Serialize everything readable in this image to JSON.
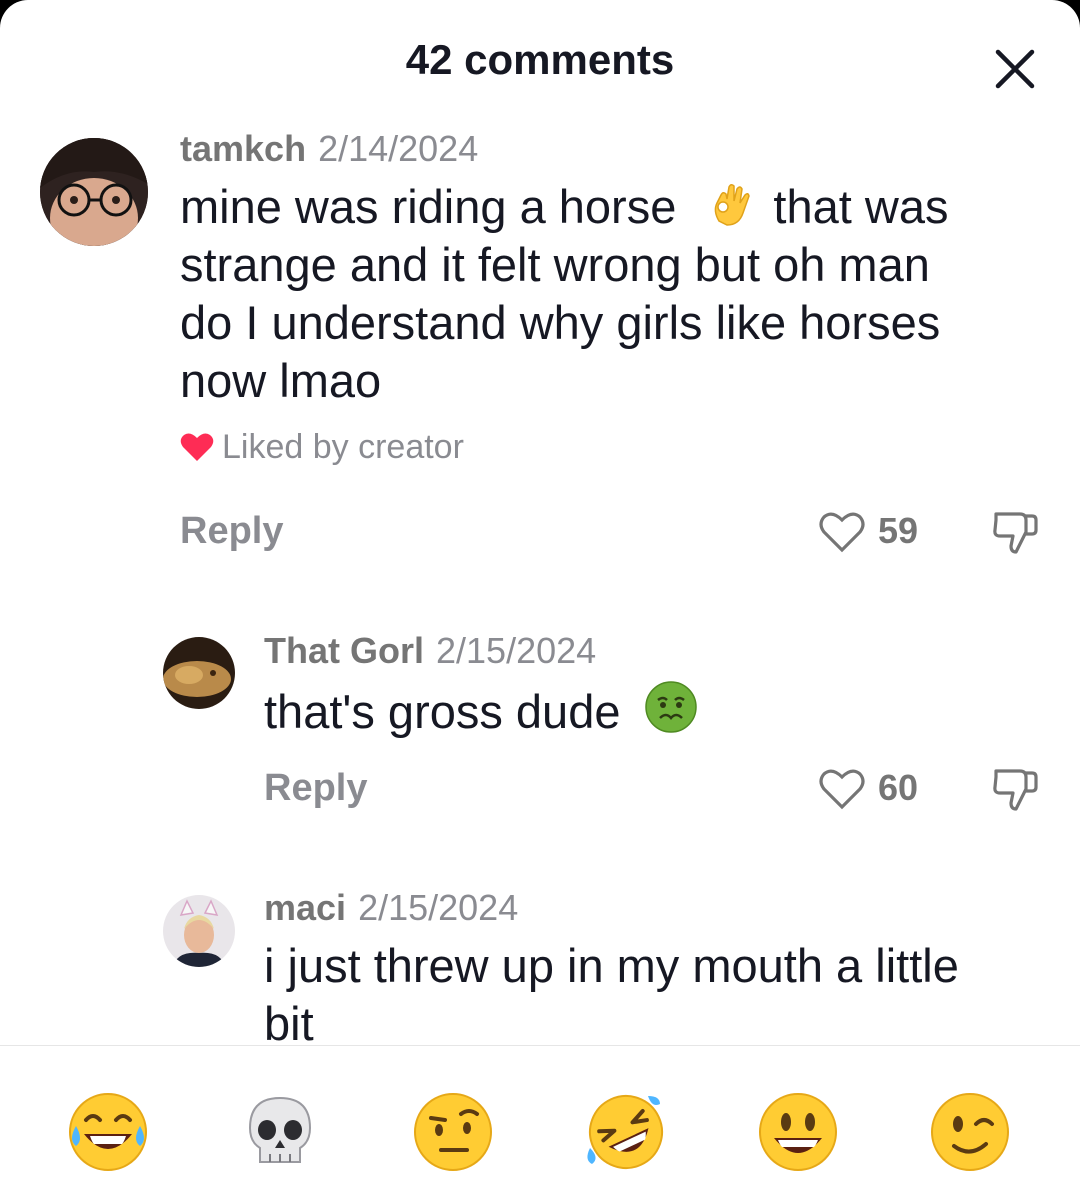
{
  "header": {
    "title": "42 comments",
    "close_icon": "close-icon"
  },
  "comments": [
    {
      "username": "tamkch",
      "date": "2/14/2024",
      "text_lines": [
        "mine was riding a horse",
        "that was",
        "strange and it felt wrong but oh man",
        "do I understand why girls like horses",
        "now lmao"
      ],
      "emoji": "ok-hand-emoji",
      "liked_by_creator": "Liked by creator",
      "reply_label": "Reply",
      "likes": "59"
    },
    {
      "username": "That Gorl",
      "date": "2/15/2024",
      "text": "that's gross dude",
      "emoji": "nauseated-face-emoji",
      "reply_label": "Reply",
      "likes": "60"
    },
    {
      "username": "maci",
      "date": "2/15/2024",
      "text_lines": [
        "i just threw up in my mouth a little",
        "bit"
      ]
    }
  ],
  "quick_emojis": [
    "tears-of-joy-emoji",
    "skull-emoji",
    "raised-eyebrow-emoji",
    "rolling-on-floor-laughing-emoji",
    "grinning-face-emoji",
    "winking-face-emoji"
  ],
  "colors": {
    "heart": "#fe2c55",
    "text": "#161823",
    "muted": "#8a8b91",
    "emoji_yellow": "#ffcc33"
  }
}
